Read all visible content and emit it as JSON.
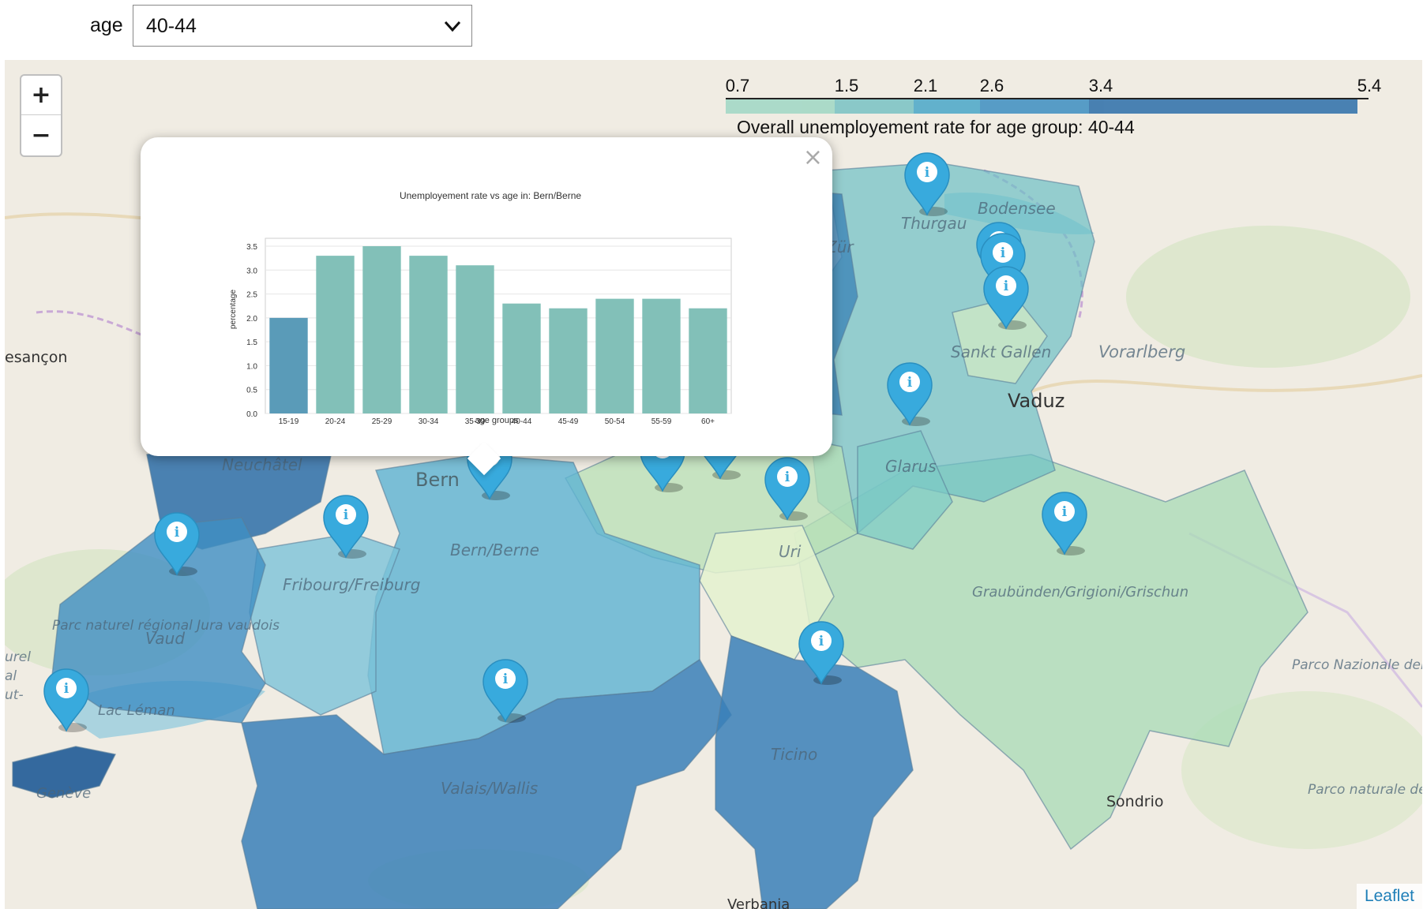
{
  "widget": {
    "label": "age",
    "selected": "40-44"
  },
  "map": {
    "zoom_in": "+",
    "zoom_out": "−",
    "attribution": "Leaflet",
    "legend": {
      "ticks": [
        "0.7",
        "1.5",
        "2.1",
        "2.6",
        "3.4",
        "5.4"
      ],
      "colors": [
        "#d4ecda",
        "#9fd7c4",
        "#79c2c4",
        "#4aa7c8",
        "#3d8fc2",
        "#2b6ea9"
      ],
      "caption": "Overall unemployement rate for age group: 40-44"
    },
    "place_labels": [
      "Thurgau",
      "Bodensee",
      "Sankt Gallen",
      "Vorarlberg",
      "Vaduz",
      "Glarus",
      "Bern",
      "Bern/Berne",
      "Fribourg/Freiburg",
      "Vaud",
      "Parc naturel régional Jura vaudois",
      "Lac Léman",
      "Genève",
      "Valais/Wallis",
      "Ticino",
      "Uri",
      "Graubünden/Grigioni/Grischun",
      "Parco Nazionale dello Stelvio",
      "Parco naturale dell'Adamello-Brenta",
      "Sondrio",
      "Neuchâtel",
      "esançon",
      "Verbania",
      "urel",
      "al",
      "ut-",
      "Zür"
    ],
    "marker_icon": "info-marker-icon"
  },
  "popup": {
    "close": "×",
    "chart_data": {
      "type": "bar",
      "title": "Unemployement rate vs age in: Bern/Berne",
      "xlabel": "age groups",
      "ylabel": "percentage",
      "categories": [
        "15-19",
        "20-24",
        "25-29",
        "30-34",
        "35-39",
        "40-44",
        "45-49",
        "50-54",
        "55-59",
        "60+"
      ],
      "values": [
        2.0,
        3.3,
        3.5,
        3.3,
        3.1,
        2.3,
        2.2,
        2.4,
        2.4,
        2.2
      ],
      "ylim": [
        0,
        3.5
      ],
      "yticks": [
        "0.0",
        "0.5",
        "1.0",
        "1.5",
        "2.0",
        "2.5",
        "3.0",
        "3.5"
      ],
      "colors": {
        "first": "#5a9bb8",
        "rest": "#82c0b8"
      },
      "grid": true
    }
  }
}
